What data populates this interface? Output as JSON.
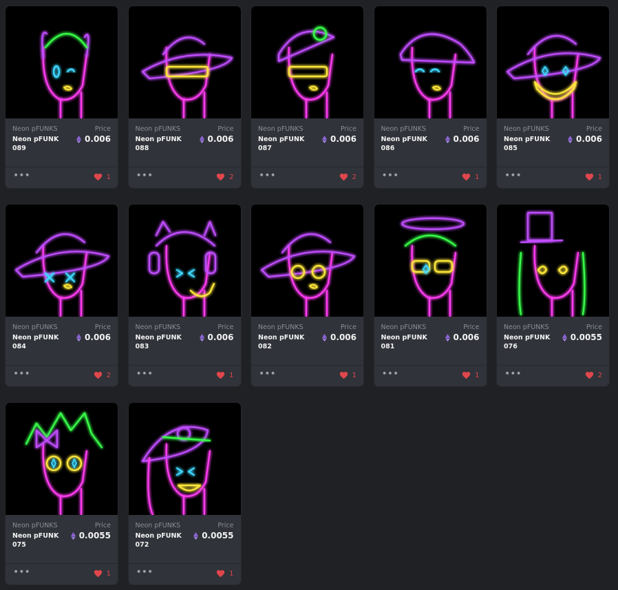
{
  "cards": [
    {
      "collection": "Neon pFUNKS",
      "name": "Neon pFUNK 089",
      "price_label": "Price",
      "price": "0.006",
      "likes": "1",
      "more": "•••",
      "icon": "ethereum-icon"
    },
    {
      "collection": "Neon pFUNKS",
      "name": "Neon pFUNK 088",
      "price_label": "Price",
      "price": "0.006",
      "likes": "2",
      "more": "•••",
      "icon": "ethereum-icon"
    },
    {
      "collection": "Neon pFUNKS",
      "name": "Neon pFUNK 087",
      "price_label": "Price",
      "price": "0.006",
      "likes": "2",
      "more": "•••",
      "icon": "ethereum-icon"
    },
    {
      "collection": "Neon pFUNKS",
      "name": "Neon pFUNK 086",
      "price_label": "Price",
      "price": "0.006",
      "likes": "1",
      "more": "•••",
      "icon": "ethereum-icon"
    },
    {
      "collection": "Neon pFUNKS",
      "name": "Neon pFUNK 085",
      "price_label": "Price",
      "price": "0.006",
      "likes": "1",
      "more": "•••",
      "icon": "ethereum-icon"
    },
    {
      "collection": "Neon pFUNKS",
      "name": "Neon pFUNK 084",
      "price_label": "Price",
      "price": "0.006",
      "likes": "2",
      "more": "•••",
      "icon": "ethereum-icon"
    },
    {
      "collection": "Neon pFUNKS",
      "name": "Neon pFUNK 083",
      "price_label": "Price",
      "price": "0.006",
      "likes": "1",
      "more": "•••",
      "icon": "ethereum-icon"
    },
    {
      "collection": "Neon pFUNKS",
      "name": "Neon pFUNK 082",
      "price_label": "Price",
      "price": "0.006",
      "likes": "1",
      "more": "•••",
      "icon": "ethereum-icon"
    },
    {
      "collection": "Neon pFUNKS",
      "name": "Neon pFUNK 081",
      "price_label": "Price",
      "price": "0.006",
      "likes": "1",
      "more": "•••",
      "icon": "ethereum-icon"
    },
    {
      "collection": "Neon pFUNKS",
      "name": "Neon pFUNK 076",
      "price_label": "Price",
      "price": "0.0055",
      "likes": "2",
      "more": "•••",
      "icon": "ethereum-icon"
    },
    {
      "collection": "Neon pFUNKS",
      "name": "Neon pFUNK 075",
      "price_label": "Price",
      "price": "0.0055",
      "likes": "1",
      "more": "•••",
      "icon": "ethereum-icon"
    },
    {
      "collection": "Neon pFUNKS",
      "name": "Neon pFUNK 072",
      "price_label": "Price",
      "price": "0.0055",
      "likes": "1",
      "more": "•••",
      "icon": "ethereum-icon"
    }
  ],
  "colors": {
    "background": "#202124",
    "card": "#303339",
    "heart": "#e0474c",
    "eth": "#8a63d2",
    "neon_pink": "#ff3df2",
    "neon_purple": "#c14dff",
    "neon_green": "#39ff4a",
    "neon_yellow": "#ffe83a",
    "neon_cyan": "#3fd9ff"
  }
}
